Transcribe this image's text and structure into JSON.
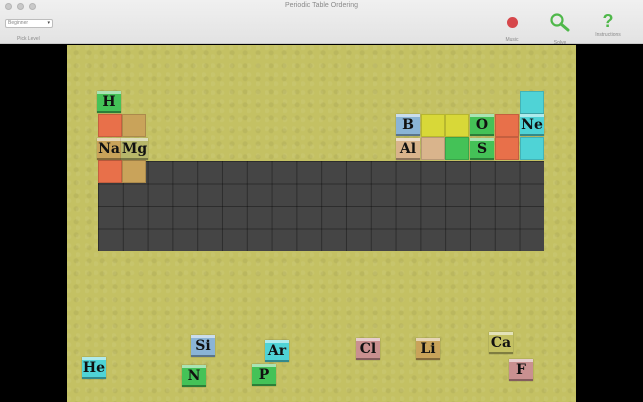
{
  "window": {
    "title": "Periodic Table Ordering"
  },
  "toolbar": {
    "level_value": "Beginner",
    "level_label": "Pick Level",
    "music_label": "Music",
    "solve_label": "Solve",
    "instructions_label": "Instructions"
  },
  "colors": {
    "alkali": "#e8704a",
    "alkaline_earth": "#c9a35a",
    "nonmetal": "#44c257",
    "noble_gas": "#4fd3d6",
    "metalloid": "#8ab4d6",
    "poor_metal": "#d9b48c",
    "halogen": "#c99090",
    "empty_yellow": "#d8d838",
    "grid_dark": "#454545",
    "board": "#c4c163"
  },
  "placed_tiles": [
    {
      "symbol": "H",
      "group": "nonmetal"
    },
    {
      "symbol": "Na",
      "group": "alkali"
    },
    {
      "symbol": "Mg",
      "group": "alkaline_earth"
    },
    {
      "symbol": "B",
      "group": "metalloid"
    },
    {
      "symbol": "O",
      "group": "nonmetal"
    },
    {
      "symbol": "Ne",
      "group": "noble_gas"
    },
    {
      "symbol": "Al",
      "group": "poor_metal"
    },
    {
      "symbol": "S",
      "group": "nonmetal"
    }
  ],
  "loose_tiles": [
    {
      "symbol": "He",
      "group": "noble_gas"
    },
    {
      "symbol": "Si",
      "group": "metalloid"
    },
    {
      "symbol": "N",
      "group": "nonmetal"
    },
    {
      "symbol": "Ar",
      "group": "noble_gas"
    },
    {
      "symbol": "P",
      "group": "nonmetal"
    },
    {
      "symbol": "Cl",
      "group": "halogen"
    },
    {
      "symbol": "Li",
      "group": "alkali"
    },
    {
      "symbol": "Ca",
      "group": "alkaline_earth"
    },
    {
      "symbol": "F",
      "group": "halogen"
    }
  ]
}
